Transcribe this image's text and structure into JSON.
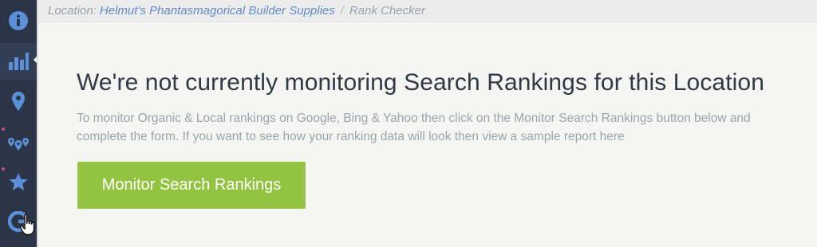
{
  "breadcrumb": {
    "location_label": "Location:",
    "location_name": "Helmut’s Phantasmagorical Builder Supplies",
    "separator": "/",
    "current": "Rank Checker"
  },
  "sidebar": {
    "items": [
      {
        "icon": "info-icon",
        "active": false
      },
      {
        "icon": "bar-chart-icon",
        "active": true
      },
      {
        "icon": "map-pin-icon",
        "active": false
      },
      {
        "icon": "multi-pin-icon",
        "active": false
      },
      {
        "icon": "star-icon",
        "active": false
      },
      {
        "icon": "google-g-icon",
        "active": false
      }
    ],
    "colors": {
      "background": "#2b3547",
      "icon": "#5b8fd6",
      "dot": "#c94a8e"
    }
  },
  "main": {
    "headline": "We're not currently monitoring Search Rankings for this Location",
    "description": "To monitor Organic & Local rankings on Google, Bing & Yahoo then click on the Monitor Search Rankings button below and complete the form. If you want to see how your ranking data will look then view a sample report here",
    "cta_label": "Monitor Search Rankings",
    "cta_color": "#93c441"
  }
}
